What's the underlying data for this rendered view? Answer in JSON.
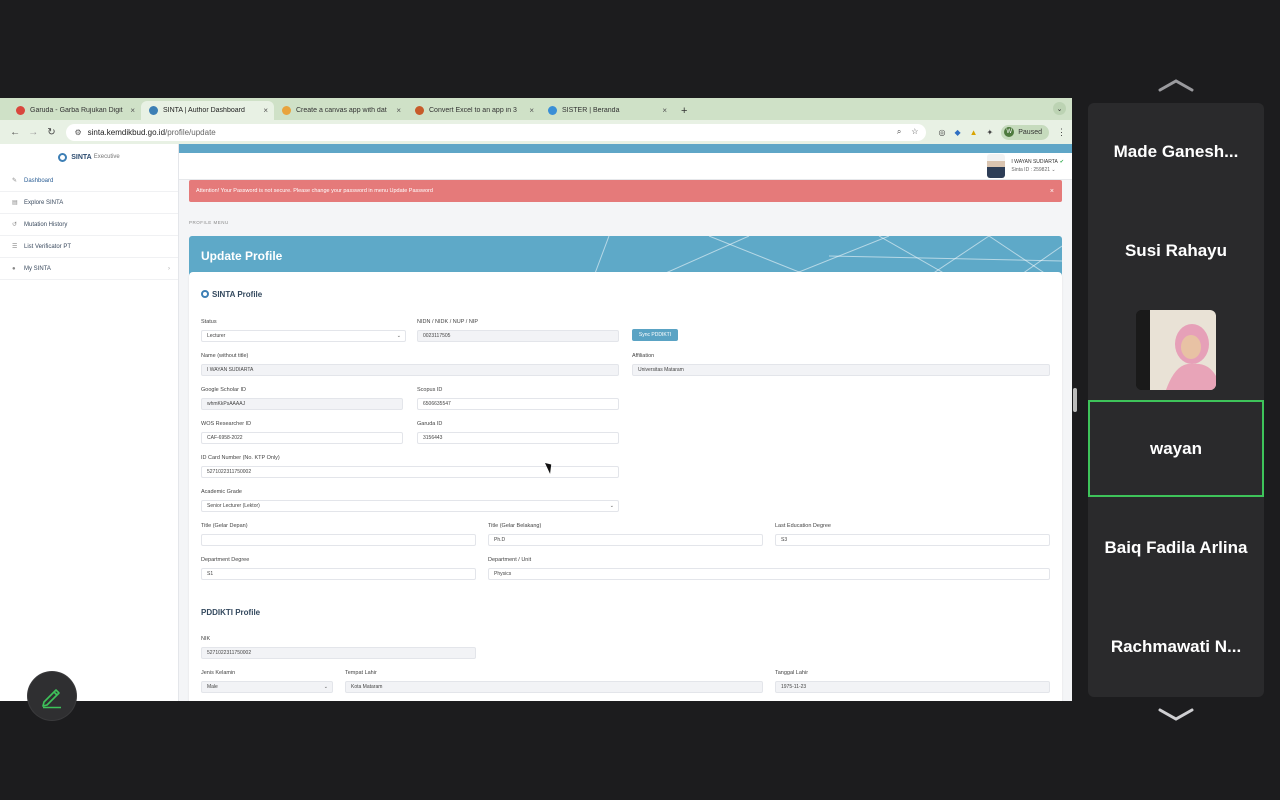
{
  "browser": {
    "tabs": [
      {
        "label": "Garuda - Garba Rujukan Digit",
        "close": "×",
        "color": "#d9473d"
      },
      {
        "label": "SINTA | Author Dashboard",
        "close": "×",
        "color": "#3d7fb5"
      },
      {
        "label": "Create a canvas app with dat",
        "close": "×",
        "color": "#e8a33d"
      },
      {
        "label": "Convert Excel to an app in 3",
        "close": "×",
        "color": "#c75b2a"
      },
      {
        "label": "SISTER | Beranda",
        "close": "×",
        "color": "#3a8fd6"
      }
    ],
    "new_tab": "+",
    "url_host": "sinta.kemdikbud.go.id",
    "url_path": "/profile/update",
    "profile_initial": "W",
    "profile_status": "Paused"
  },
  "sidebar": {
    "brand": "SINTA",
    "brand_sub": "Executive",
    "items": [
      {
        "label": "Dashboard",
        "icon": "edit-icon"
      },
      {
        "label": "Explore SINTA",
        "icon": "document-icon"
      },
      {
        "label": "Mutation History",
        "icon": "history-icon"
      },
      {
        "label": "List Verificator PT",
        "icon": "list-icon"
      },
      {
        "label": "My SINTA",
        "icon": "user-icon",
        "arrow": "›"
      }
    ]
  },
  "user": {
    "name": "I WAYAN SUDIARTA",
    "sinta_id": "Sinta ID : 259821",
    "caret": "⌄"
  },
  "alert": {
    "text": "Attention! Your Password is not secure. Please change your password in menu Update Password",
    "close": "×"
  },
  "profile_menu_label": "PROFILE MENU",
  "hero_title": "Update Profile",
  "sinta_profile": {
    "heading": "SINTA Profile",
    "status_label": "Status",
    "status_value": "Lecturer",
    "nidn_label": "NIDN / NIDK / NUP / NIP",
    "nidn_value": "0023117505",
    "sync_button": "Sync PDDIKTI",
    "name_label": "Name (without title)",
    "name_value": "I WAYAN SUDIARTA",
    "affiliation_label": "Affiliation",
    "affiliation_value": "Universitas Mataram",
    "scholar_label": "Google Scholar ID",
    "scholar_value": "whmKkPsAAAAJ",
    "scopus_label": "Scopus ID",
    "scopus_value": "6506635547",
    "wos_label": "WOS Researcher ID",
    "wos_value": "CAF-6958-2022",
    "garuda_label": "Garuda ID",
    "garuda_value": "3156443",
    "ktp_label": "ID Card Number (No. KTP Only)",
    "ktp_value": "5271022311750002",
    "grade_label": "Academic Grade",
    "grade_value": "Senior Lecturer (Lektor)",
    "title_front_label": "Title (Gelar Depan)",
    "title_front_value": "",
    "title_back_label": "Title (Gelar Belakang)",
    "title_back_value": "Ph.D",
    "last_edu_label": "Last Education Degree",
    "last_edu_value": "S3",
    "dept_degree_label": "Department Degree",
    "dept_degree_value": "S1",
    "dept_unit_label": "Department / Unit",
    "dept_unit_value": "Physics"
  },
  "pddikti_profile": {
    "heading": "PDDIKTI Profile",
    "nik_label": "NIK",
    "nik_value": "5271022311750002",
    "gender_label": "Jenis Kelamin",
    "gender_value": "Male",
    "birthplace_label": "Tempat Lahir",
    "birthplace_value": "Kota Mataram",
    "birthdate_label": "Tanggal Lahir",
    "birthdate_value": "1975-11-23"
  },
  "participants": [
    {
      "name": "Made Ganesh..."
    },
    {
      "name": "Susi Rahayu"
    },
    {
      "name": "",
      "video": true
    },
    {
      "name": "wayan",
      "active": true
    },
    {
      "name": "Baiq Fadila Arlina"
    },
    {
      "name": "Rachmawati N..."
    }
  ],
  "colors": {
    "accent": "#5ea9c8",
    "alert": "#e57a7a",
    "active_border": "#3ec35a"
  }
}
